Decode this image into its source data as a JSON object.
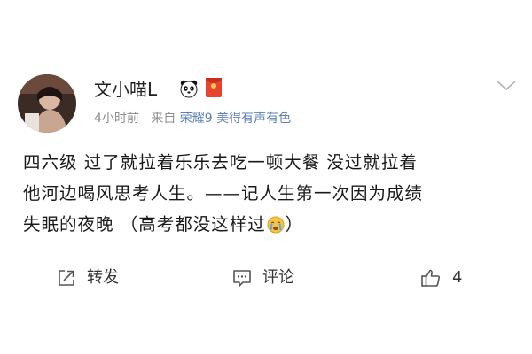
{
  "post": {
    "user": {
      "name": "文小喵L",
      "badge_icon": "panda-icon",
      "redpacket_icon": "red-envelope-icon"
    },
    "meta": {
      "time": "4小时前",
      "from": "来自",
      "source": "荣耀9 美得有声有色"
    },
    "content": {
      "line1": "四六级 过了就拉着乐乐去吃一顿大餐 没过就拉着",
      "line2": "他河边喝风思考人生。——记人生第一次因为成绩",
      "line3_text": "失眠的夜晚 （高考都没这样过",
      "line3_end": "）",
      "emoji": "crying-face-icon"
    },
    "actions": {
      "repost_label": "转发",
      "comment_label": "评论",
      "like_count": "4"
    },
    "colors": {
      "meta_gray": "#8c8c8c",
      "source_blue": "#5c7fb4",
      "text": "#1a1a1a"
    }
  }
}
